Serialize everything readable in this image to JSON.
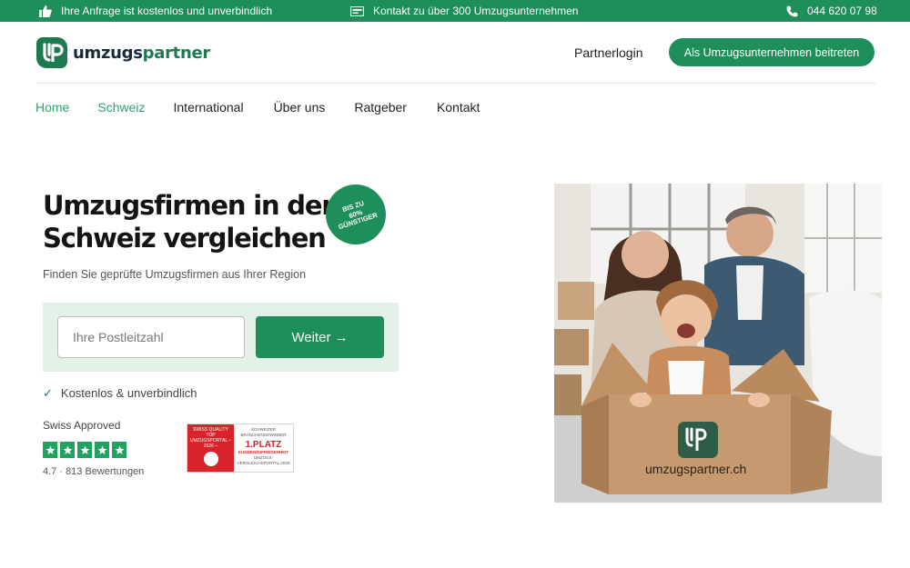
{
  "topbar": {
    "free_request": "Ihre Anfrage ist kostenlos und unverbindlich",
    "contact_companies": "Kontakt zu über 300 Umzugsunternehmen",
    "phone": "044 620 07 98"
  },
  "header": {
    "logo_part1": "umzugs",
    "logo_part2": "partner",
    "partner_login": "Partnerlogin",
    "join_button": "Als Umzugsunternehmen beitreten"
  },
  "nav": {
    "items": [
      "Home",
      "Schweiz",
      "International",
      "Über uns",
      "Ratgeber",
      "Kontakt"
    ]
  },
  "hero": {
    "title": "Umzugsfirmen in der Schweiz vergleichen",
    "badge_line1": "Bis zu",
    "badge_line2": "60%",
    "badge_line3": "günstiger",
    "subtitle": "Finden Sie geprüfte Umzugsfirmen aus Ihrer Region",
    "postal_placeholder": "Ihre Postleitzahl",
    "postal_value": "",
    "submit_button": "Weiter →",
    "check_text": "Kostenlos & unverbindlich"
  },
  "trust": {
    "approved_label": "Swiss Approved",
    "stars": 5,
    "rating_text": "4.7 · 813 Bewertungen",
    "award_top": "SWISS QUALITY",
    "award_left": "TOP UMZUGSPORTAL – 2026 –",
    "award_right_top": "SCHWEIZER BRANCHENGEWINNER",
    "award_place": "1.PLATZ",
    "award_place_sub": "KUNDENZUFRIEDENHEIT",
    "award_right_bottom": "UMZUGS-VERGLEICHSPORTAL 2026"
  },
  "photo": {
    "box_text": "umzugspartner.ch"
  },
  "colors": {
    "brand_green": "#1e8e5a",
    "light_green": "#e3f1e9",
    "active_nav": "#2aa36b",
    "star_green": "#21a35f"
  }
}
